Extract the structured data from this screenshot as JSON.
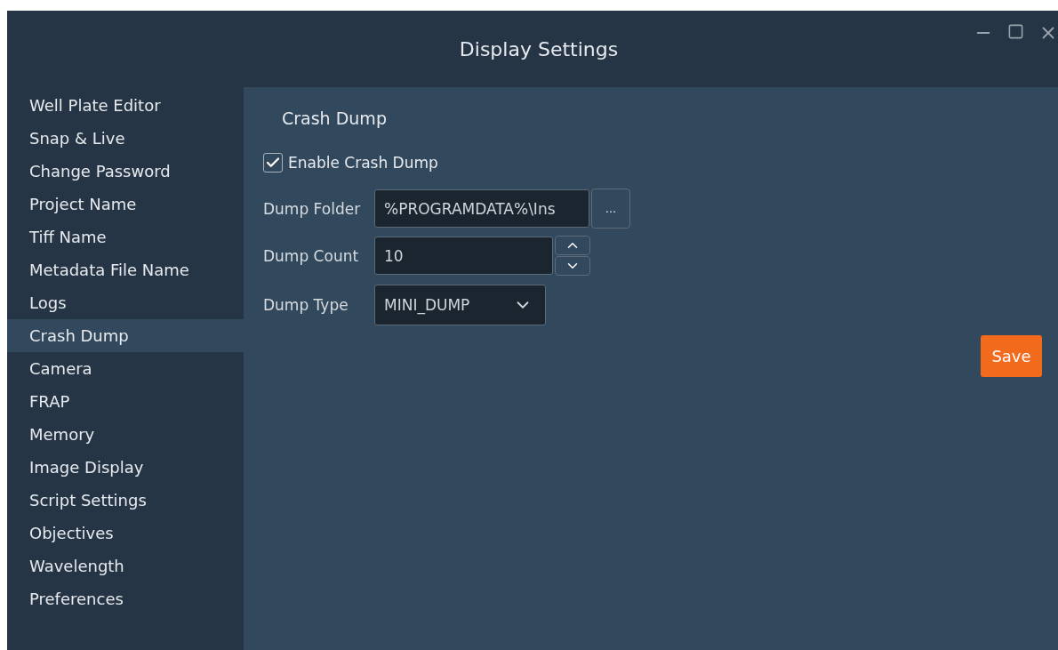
{
  "window": {
    "title": "Display Settings"
  },
  "sidebar": {
    "items": [
      {
        "label": "Well Plate Editor",
        "selected": false
      },
      {
        "label": "Snap & Live",
        "selected": false
      },
      {
        "label": "Change Password",
        "selected": false
      },
      {
        "label": "Project Name",
        "selected": false
      },
      {
        "label": "Tiff Name",
        "selected": false
      },
      {
        "label": "Metadata File Name",
        "selected": false
      },
      {
        "label": "Logs",
        "selected": false
      },
      {
        "label": "Crash Dump",
        "selected": true
      },
      {
        "label": "Camera",
        "selected": false
      },
      {
        "label": "FRAP",
        "selected": false
      },
      {
        "label": "Memory",
        "selected": false
      },
      {
        "label": "Image Display",
        "selected": false
      },
      {
        "label": "Script Settings",
        "selected": false
      },
      {
        "label": "Objectives",
        "selected": false
      },
      {
        "label": "Wavelength",
        "selected": false
      },
      {
        "label": "Preferences",
        "selected": false
      }
    ]
  },
  "panel": {
    "heading": "Crash Dump",
    "enable": {
      "label": "Enable Crash Dump",
      "checked": true
    },
    "fields": [
      {
        "kind": "path",
        "label": "Dump Folder",
        "value": "%PROGRAMDATA%\\Ins",
        "button": "..."
      },
      {
        "kind": "spinner",
        "label": "Dump Count",
        "value": "10"
      },
      {
        "kind": "dropdown",
        "label": "Dump Type",
        "value": "MINI_DUMP"
      }
    ],
    "save": "Save"
  }
}
